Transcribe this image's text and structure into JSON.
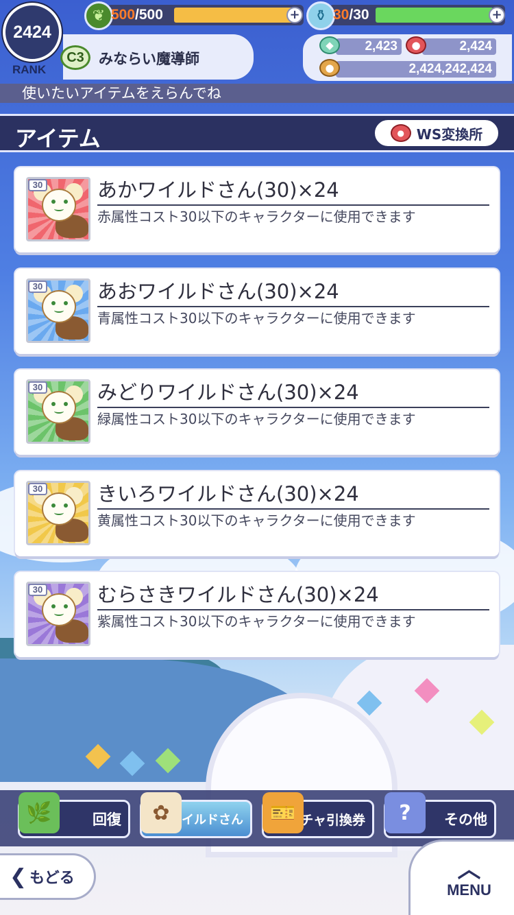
{
  "player": {
    "rank_value": "2424",
    "rank_label": "RANK",
    "class_badge": "C3",
    "name": "みならい魔導師"
  },
  "stamina": {
    "current": "500",
    "max": "/500",
    "fill": 1.0,
    "icon": "leaf-icon"
  },
  "potion": {
    "current": "30",
    "max": "/30",
    "fill": 1.0,
    "icon": "bottle-icon"
  },
  "currencies": {
    "gems": "2,423",
    "ws": "2,424",
    "coins": "2,424,242,424"
  },
  "instruction": "使いたいアイテムをえらんでね",
  "header": {
    "title": "アイテム",
    "exchange_label": "WS変換所"
  },
  "items": [
    {
      "cost": "30",
      "name": "あかワイルドさん(30)×24",
      "desc": "赤属性コスト30以下のキャラクターに使用できます",
      "color": "#f0666e"
    },
    {
      "cost": "30",
      "name": "あおワイルドさん(30)×24",
      "desc": "青属性コスト30以下のキャラクターに使用できます",
      "color": "#6aa9ef"
    },
    {
      "cost": "30",
      "name": "みどりワイルドさん(30)×24",
      "desc": "緑属性コスト30以下のキャラクターに使用できます",
      "color": "#6cc36a"
    },
    {
      "cost": "30",
      "name": "きいろワイルドさん(30)×24",
      "desc": "黄属性コスト30以下のキャラクターに使用できます",
      "color": "#f1c84a"
    },
    {
      "cost": "30",
      "name": "むらさきワイルドさん(30)×24",
      "desc": "紫属性コスト30以下のキャラクターに使用できます",
      "color": "#9a78d8"
    }
  ],
  "tabs": [
    {
      "label": "回復",
      "icon": "herb-bottle-icon"
    },
    {
      "label": "WSワイルドさん",
      "icon": "wild-san-icon"
    },
    {
      "label": "ガチャ引換券",
      "icon": "ticket-icon"
    },
    {
      "label": "その他",
      "icon": "mystery-card-icon"
    }
  ],
  "footer": {
    "back_label": "もどる",
    "menu_label": "MENU"
  },
  "colors": {
    "navy": "#2b3161",
    "stamina": "#f5bd45",
    "potion": "#6ad75e",
    "cost_orange": "#ff7c2a"
  }
}
